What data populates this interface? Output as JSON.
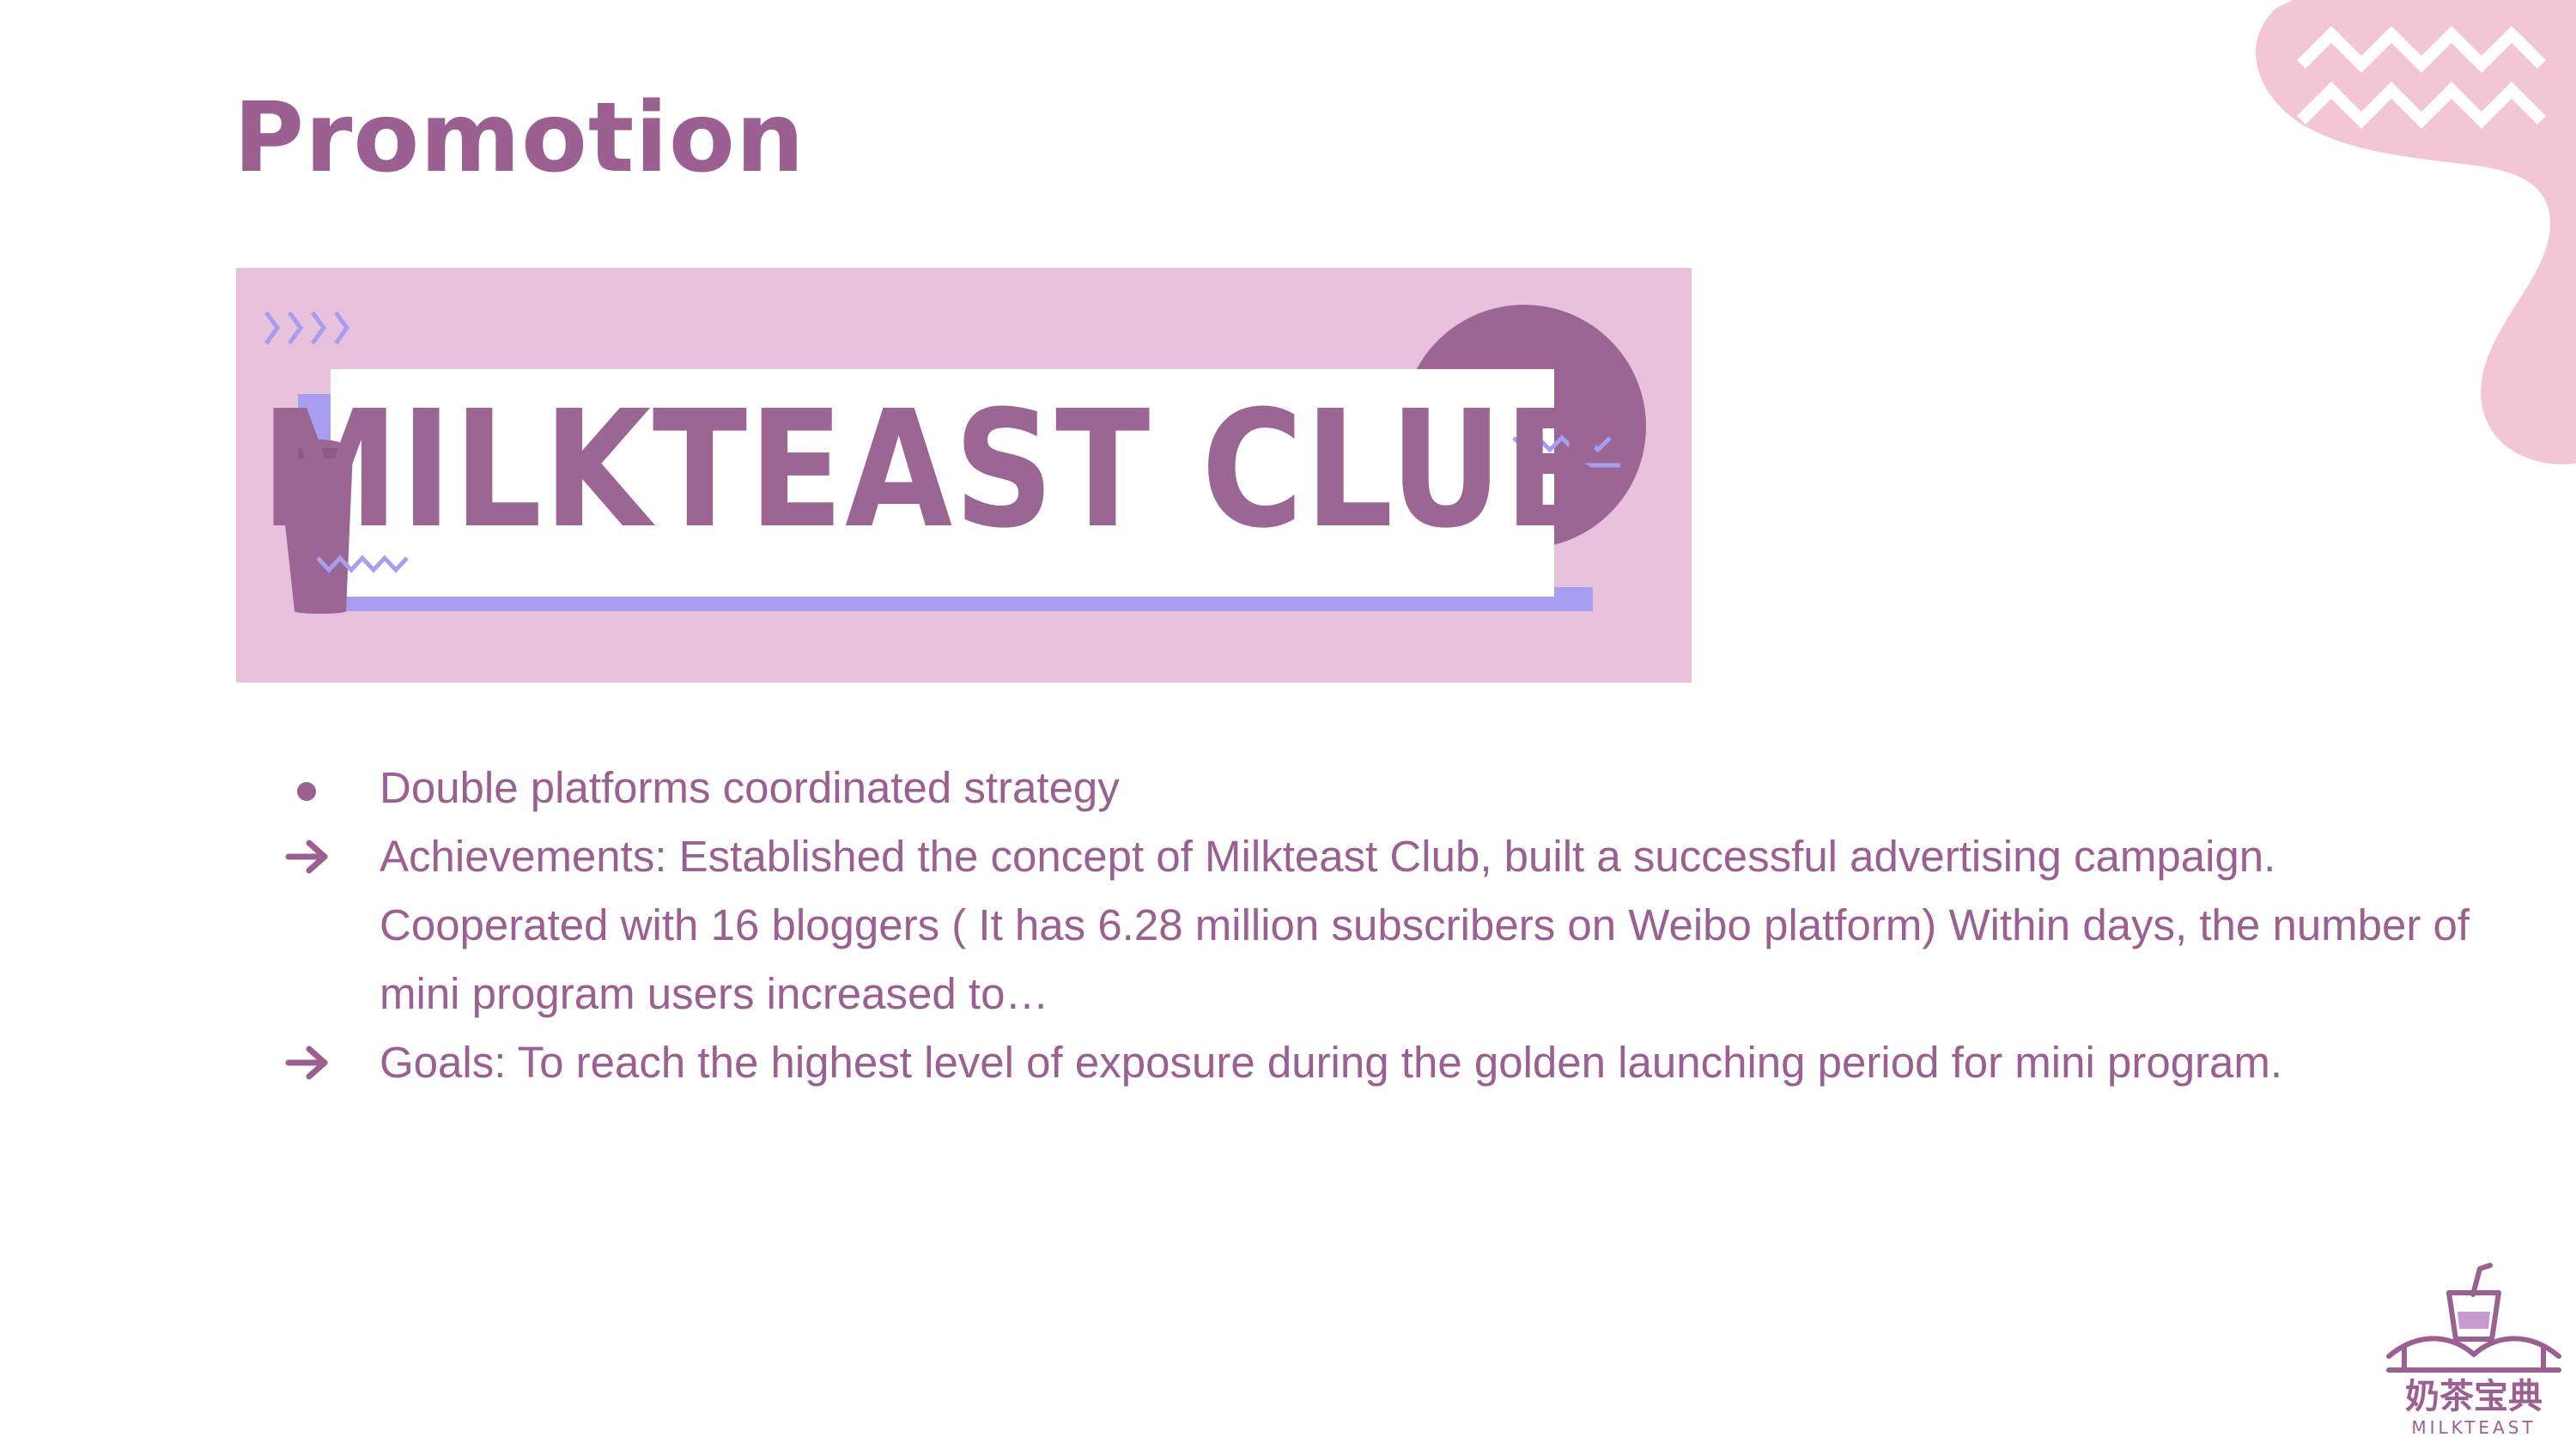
{
  "slide": {
    "title": "Promotion"
  },
  "banner": {
    "title": "MILKTEAST CLUB"
  },
  "bullets": [
    {
      "marker": "dot-icon",
      "text": "Double platforms coordinated strategy"
    },
    {
      "marker": "arrow-right-icon",
      "text": "Achievements: Established the concept of Milkteast Club, built a successful advertising campaign. Cooperated with 16 bloggers ( It has 6.28 million subscribers on Weibo platform) Within days, the number of mini program users increased to…"
    },
    {
      "marker": "arrow-right-icon",
      "text": "Goals: To reach the highest level of exposure during the golden launching period for mini program."
    }
  ],
  "logo": {
    "chinese": "奶茶宝典",
    "english": "MILKTEAST"
  },
  "colors": {
    "accent": "#9b5f92",
    "banner_bg": "#e8c2dc",
    "blob": "#f3c6d6",
    "lavender": "#a79ef0"
  }
}
